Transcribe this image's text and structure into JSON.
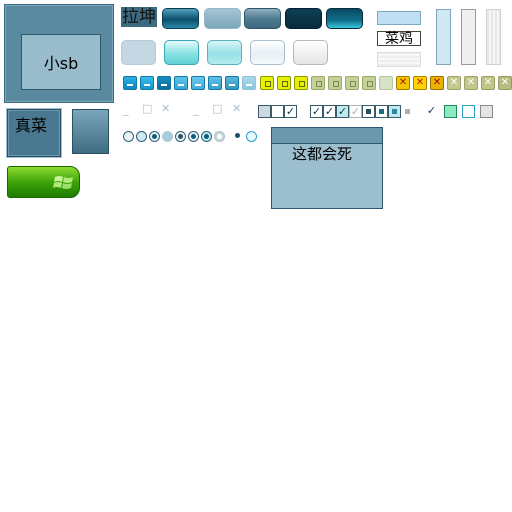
{
  "big_panel": {
    "label": "小sb"
  },
  "top_row": {
    "label_button": "拉坤"
  },
  "edits": {
    "middle_text": "菜鸡"
  },
  "small_box": {
    "label": "真菜"
  },
  "dialog": {
    "body_text": "这都会死"
  },
  "colors": {
    "panel": "#5a8aa0",
    "accent_blue": "#0e7aa8",
    "accent_yellow": "#e8f000",
    "start_green": "#3ea30a"
  },
  "icons": [
    "minimize-icon",
    "maximize-icon",
    "close-icon",
    "check-icon",
    "windows-logo-icon"
  ]
}
